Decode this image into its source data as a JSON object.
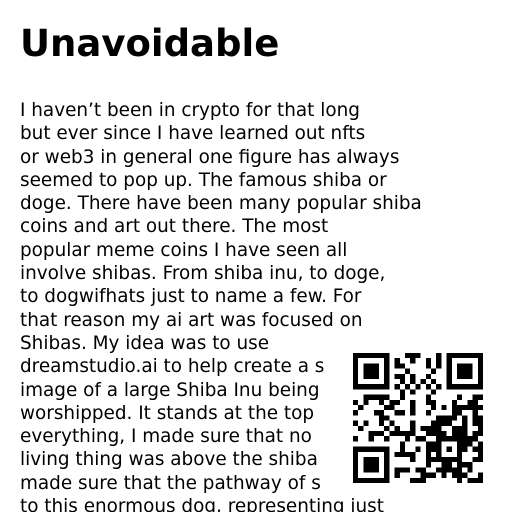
{
  "document": {
    "title": "Unavoidable",
    "body_lines": [
      "I haven’t been in crypto for that long",
      "but ever since I have learned out nfts",
      "or web3 in general one figure has always",
      "seemed to pop up. The famous shiba or",
      "doge. There have been many popular shiba",
      "coins and art out there. The most",
      "popular meme coins I have seen all",
      "involve shibas. From shiba inu, to doge,",
      "to dogwifhats just to name a few. For",
      "that reason my ai art was focused on",
      "Shibas. My idea was to use",
      "dreamstudio.ai to help create a s",
      "image of a large Shiba Inu being",
      "worshipped. It stands at the top",
      "everything, I made sure that no",
      "living thing was above the shiba",
      "made sure that the pathway of s",
      "to this enormous dog, representing just"
    ]
  },
  "qr_code": {
    "icon": "qr-code-icon",
    "foreground": "#000000",
    "background": "#ffffff"
  }
}
